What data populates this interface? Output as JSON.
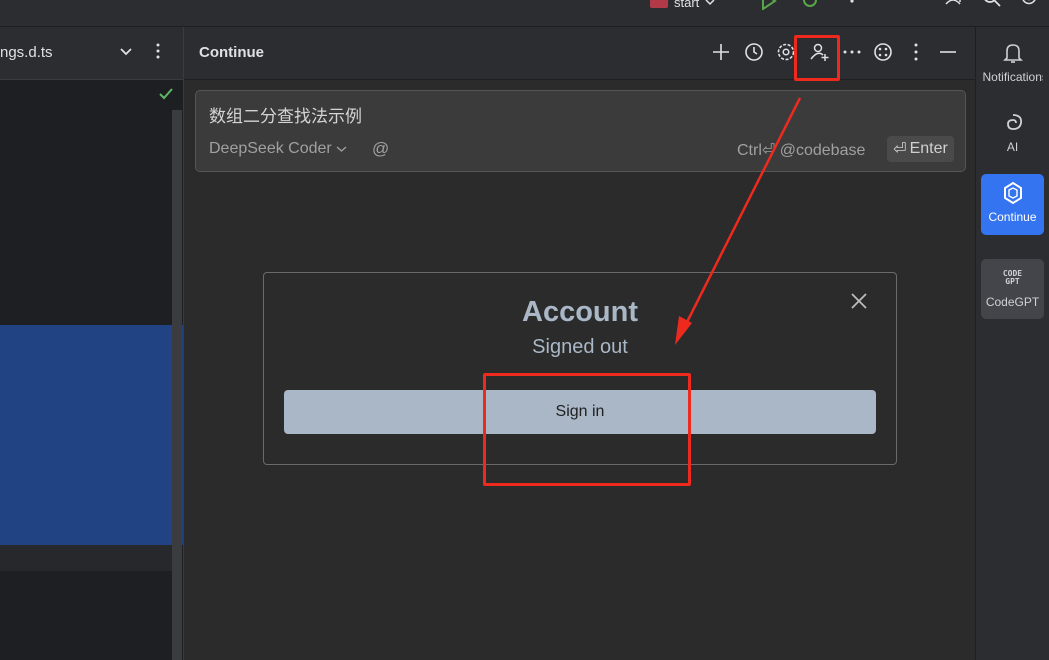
{
  "toolbar": {
    "run_config": "start",
    "icons": [
      "run-icon",
      "debug-icon",
      "more-icon",
      "add-user-icon",
      "search-icon",
      "settings-icon"
    ]
  },
  "editor": {
    "file_tab": "ngs.d.ts",
    "status_icon": "check-icon",
    "selection_color": "#214283"
  },
  "continue_panel": {
    "title": "Continue",
    "header_icons": [
      "plus-icon",
      "history-icon",
      "gear-icon",
      "account-icon",
      "ellipsis-horizontal-icon",
      "extensions-icon",
      "ellipsis-vertical-icon",
      "minimize-icon"
    ],
    "input": {
      "text": "数组二分查找法示例",
      "model": "DeepSeek Coder",
      "at_symbol": "@",
      "shortcut_hint": "Ctrl⏎ @codebase",
      "enter_label": "Enter",
      "enter_glyph": "⏎"
    }
  },
  "account_dialog": {
    "title": "Account",
    "status": "Signed out",
    "signin_label": "Sign in",
    "accent": "#a9b7c6"
  },
  "right_tools": [
    {
      "label": "Notifications",
      "icon": "bell-icon"
    },
    {
      "label": "AI",
      "icon": "ai-swirl-icon"
    },
    {
      "label": "Continue",
      "icon": "continue-logo-icon",
      "active": true,
      "color": "#3574f0"
    },
    {
      "label": "CodeGPT",
      "icon": "codegpt-logo-icon",
      "logo_text": "CODE GPT"
    }
  ],
  "annotations": {
    "color": "#ee2a1f",
    "items": [
      "highlight-account-icon",
      "highlight-sign-in-button",
      "arrow-account-to-signin"
    ]
  }
}
